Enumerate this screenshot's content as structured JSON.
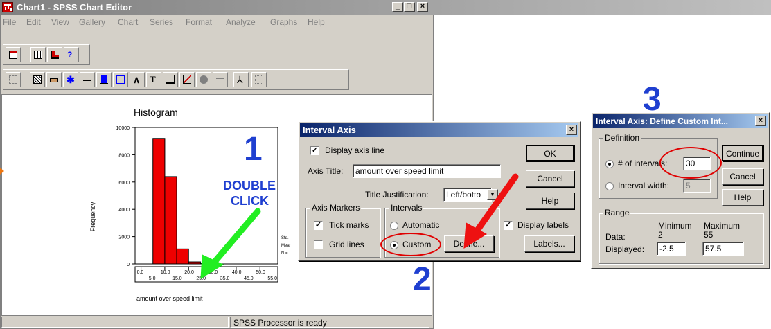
{
  "main_window": {
    "title": "Chart1 - SPSS Chart Editor",
    "menu": [
      "File",
      "Edit",
      "View",
      "Gallery",
      "Chart",
      "Series",
      "Format",
      "Analyze",
      "Graphs",
      "Help"
    ],
    "status": "SPSS Processor  is ready"
  },
  "chart": {
    "title": "Histogram",
    "ylabel": "Frequency",
    "xlabel": "amount over speed limit",
    "y_ticks": [
      "10000",
      "8000",
      "6000",
      "4000",
      "2000",
      "0"
    ],
    "x_ticks_top": [
      "0.0",
      "10.0",
      "20.0",
      "30.0",
      "40.0",
      "50.0"
    ],
    "x_ticks_bottom": [
      "5.0",
      "15.0",
      "25.0",
      "35.0",
      "45.0",
      "55.0"
    ],
    "stats_labels": [
      "Std.",
      "Mear",
      "N ="
    ]
  },
  "chart_data": {
    "type": "bar",
    "title": "Histogram",
    "xlabel": "amount over speed limit",
    "ylabel": "Frequency",
    "bin_starts": [
      0,
      5,
      10,
      15,
      20,
      25,
      30,
      35,
      40,
      45,
      50
    ],
    "values": [
      0,
      9200,
      6400,
      1100,
      150,
      30,
      0,
      0,
      0,
      0,
      0
    ],
    "ylim": [
      0,
      10000
    ],
    "xlim": [
      -2.5,
      57.5
    ]
  },
  "annotations": {
    "step1_number": "1",
    "step1_text_line1": "DOUBLE",
    "step1_text_line2": "CLICK",
    "step2_number": "2",
    "step3_number": "3",
    "arrow_colors": {
      "green": "#22ee22",
      "red": "#ee1111"
    }
  },
  "interval_axis_dialog": {
    "title": "Interval Axis",
    "close_symbol": "×",
    "display_axis_line_label": "Display axis line",
    "display_axis_line_checked": true,
    "axis_title_label": "Axis Title:",
    "axis_title_value": "amount over speed limit",
    "title_justification_label": "Title Justification:",
    "title_justification_value": "Left/botto",
    "axis_markers_group": "Axis Markers",
    "tick_marks_label": "Tick marks",
    "tick_marks_checked": true,
    "grid_lines_label": "Grid lines",
    "grid_lines_checked": false,
    "intervals_group": "Intervals",
    "automatic_label": "Automatic",
    "custom_label": "Custom",
    "selected_interval": "Custom",
    "define_label": "Define...",
    "display_labels_label": "Display labels",
    "display_labels_checked": true,
    "ok_label": "OK",
    "cancel_label": "Cancel",
    "help_label": "Help",
    "labels_label": "Labels..."
  },
  "define_custom_dialog": {
    "title": "Interval Axis: Define Custom Int...",
    "close_symbol": "×",
    "definition_group": "Definition",
    "num_intervals_label": "# of intervals:",
    "num_intervals_value": "30",
    "interval_width_label": "Interval width:",
    "interval_width_value": "5",
    "selected_option": "# of intervals",
    "range_group": "Range",
    "minimum_header": "Minimum",
    "maximum_header": "Maximum",
    "data_label": "Data:",
    "data_min": "2",
    "data_max": "55",
    "displayed_label": "Displayed:",
    "displayed_min": "-2.5",
    "displayed_max": "57.5",
    "continue_label": "Continue",
    "cancel_label": "Cancel",
    "help_label": "Help"
  }
}
